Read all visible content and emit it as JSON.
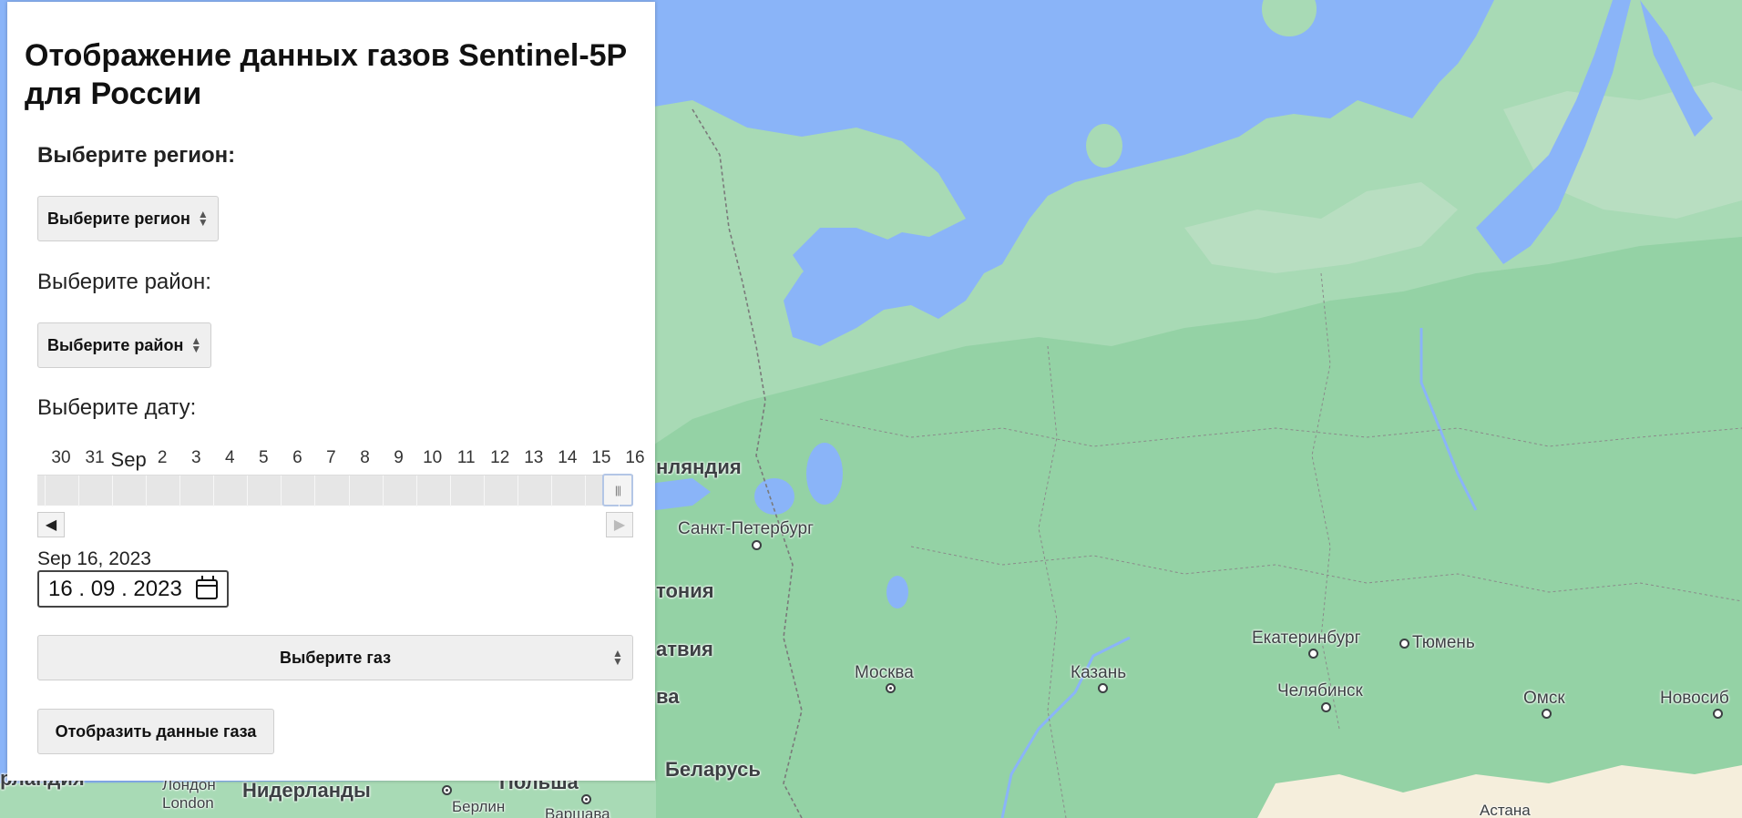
{
  "panel": {
    "title": "Отображение данных газов Sentinel-5P для России",
    "region_label": "Выберите регион:",
    "region_select": "Выберите регион",
    "district_label": "Выберите район:",
    "district_select": "Выберите район",
    "date_label": "Выберите дату:",
    "slider_ticks": [
      "30",
      "31",
      "Sep",
      "2",
      "3",
      "4",
      "5",
      "6",
      "7",
      "8",
      "9",
      "10",
      "11",
      "12",
      "13",
      "14",
      "15",
      "16"
    ],
    "slider_value": 1.0,
    "prev_icon": "◀",
    "next_icon": "▶",
    "date_text": "Sep 16, 2023",
    "date_input": "16 . 09 . 2023",
    "gas_select": "Выберите газ",
    "show_button": "Отобразить данные газа"
  },
  "map": {
    "colors": {
      "water": "#8ab4f8",
      "land": "#a8dab5",
      "forest": "#94d2a5",
      "tundra": "#bcdfc4",
      "desert": "#f5eedc"
    },
    "countries": [
      "нляндия",
      "тония",
      "атвия",
      "ва",
      "Беларусь",
      "Польша",
      "Нидерланды",
      "рландия"
    ],
    "cities": [
      "Санкт-Петербург",
      "Москва",
      "Казань",
      "Екатеринбург",
      "Тюмень",
      "Челябинск",
      "Омск",
      "Новосиб",
      "Лондон",
      "London",
      "Берлин",
      "Варшава",
      "Астана"
    ]
  }
}
